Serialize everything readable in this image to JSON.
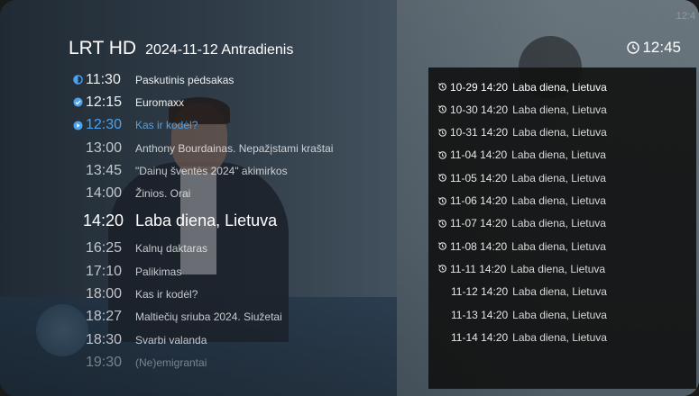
{
  "header": {
    "channel": "LRT HD",
    "date": "2024-11-12 Antradienis",
    "clock": "12:45",
    "ghost_clock": "12:4"
  },
  "epg": [
    {
      "time": "11:30",
      "title": "Paskutinis pėdsakas",
      "status": "past-partial"
    },
    {
      "time": "12:15",
      "title": "Euromaxx",
      "status": "watched"
    },
    {
      "time": "12:30",
      "title": "Kas ir kodėl?",
      "status": "playing"
    },
    {
      "time": "13:00",
      "title": "Anthony Bourdainas. Nepažįstami kraštai",
      "status": "future"
    },
    {
      "time": "13:45",
      "title": "\"Dainų šventės 2024\" akimirkos",
      "status": "future"
    },
    {
      "time": "14:00",
      "title": "Žinios. Orai",
      "status": "future"
    },
    {
      "time": "14:20",
      "title": "Laba diena, Lietuva",
      "status": "current"
    },
    {
      "time": "16:25",
      "title": "Kalnų daktaras",
      "status": "future"
    },
    {
      "time": "17:10",
      "title": "Palikimas",
      "status": "future"
    },
    {
      "time": "18:00",
      "title": "Kas ir kodėl?",
      "status": "future"
    },
    {
      "time": "18:27",
      "title": "Maltiečių sriuba 2024. Siužetai",
      "status": "future"
    },
    {
      "time": "18:30",
      "title": "Svarbi valanda",
      "status": "future"
    },
    {
      "time": "19:30",
      "title": "(Ne)emigrantai",
      "status": "faded"
    }
  ],
  "archive": [
    {
      "datetime": "10-29 14:20",
      "title": "Laba diena, Lietuva",
      "recorded": true,
      "selected": true
    },
    {
      "datetime": "10-30 14:20",
      "title": "Laba diena, Lietuva",
      "recorded": true,
      "selected": false
    },
    {
      "datetime": "10-31 14:20",
      "title": "Laba diena, Lietuva",
      "recorded": true,
      "selected": false
    },
    {
      "datetime": "11-04 14:20",
      "title": "Laba diena, Lietuva",
      "recorded": true,
      "selected": false
    },
    {
      "datetime": "11-05 14:20",
      "title": "Laba diena, Lietuva",
      "recorded": true,
      "selected": false
    },
    {
      "datetime": "11-06 14:20",
      "title": "Laba diena, Lietuva",
      "recorded": true,
      "selected": false
    },
    {
      "datetime": "11-07 14:20",
      "title": "Laba diena, Lietuva",
      "recorded": true,
      "selected": false
    },
    {
      "datetime": "11-08 14:20",
      "title": "Laba diena, Lietuva",
      "recorded": true,
      "selected": false
    },
    {
      "datetime": "11-11 14:20",
      "title": "Laba diena, Lietuva",
      "recorded": true,
      "selected": false
    },
    {
      "datetime": "11-12 14:20",
      "title": "Laba diena, Lietuva",
      "recorded": false,
      "selected": false
    },
    {
      "datetime": "11-13 14:20",
      "title": "Laba diena, Lietuva",
      "recorded": false,
      "selected": false
    },
    {
      "datetime": "11-14 14:20",
      "title": "Laba diena, Lietuva",
      "recorded": false,
      "selected": false
    }
  ],
  "colors": {
    "accent": "#4aa3ee"
  },
  "icons": {
    "clock": "clock-icon",
    "archive": "history-icon",
    "watched": "check-circle-icon",
    "playing": "play-circle-icon",
    "partial": "half-circle-icon"
  }
}
